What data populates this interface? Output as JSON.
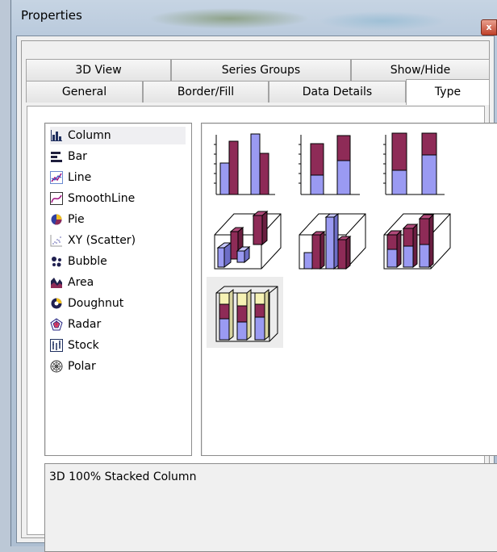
{
  "window": {
    "title": "Properties",
    "close_glyph": "x"
  },
  "tabs": {
    "row1": [
      {
        "label": "3D View"
      },
      {
        "label": "Series Groups"
      },
      {
        "label": "Show/Hide"
      }
    ],
    "row2": [
      {
        "label": "General"
      },
      {
        "label": "Border/Fill"
      },
      {
        "label": "Data Details"
      },
      {
        "label": "Type",
        "active": true
      }
    ]
  },
  "chart_types": [
    {
      "label": "Column",
      "icon": "column-chart-icon",
      "selected": true
    },
    {
      "label": "Bar",
      "icon": "bar-chart-icon"
    },
    {
      "label": "Line",
      "icon": "line-chart-icon"
    },
    {
      "label": "SmoothLine",
      "icon": "smoothline-chart-icon"
    },
    {
      "label": "Pie",
      "icon": "pie-chart-icon"
    },
    {
      "label": "XY (Scatter)",
      "icon": "scatter-chart-icon"
    },
    {
      "label": "Bubble",
      "icon": "bubble-chart-icon"
    },
    {
      "label": "Area",
      "icon": "area-chart-icon"
    },
    {
      "label": "Doughnut",
      "icon": "doughnut-chart-icon"
    },
    {
      "label": "Radar",
      "icon": "radar-chart-icon"
    },
    {
      "label": "Stock",
      "icon": "stock-chart-icon"
    },
    {
      "label": "Polar",
      "icon": "polar-chart-icon"
    }
  ],
  "subtypes": [
    {
      "icon": "clustered-column-icon"
    },
    {
      "icon": "stacked-column-icon"
    },
    {
      "icon": "100-stacked-column-icon"
    },
    {
      "icon": "3d-column-icon"
    },
    {
      "icon": "3d-clustered-column-icon"
    },
    {
      "icon": "3d-stacked-column-icon"
    },
    {
      "icon": "3d-100-stacked-column-icon",
      "selected": true
    }
  ],
  "description": "3D 100% Stacked Column",
  "colors": {
    "series1": "#9a9af2",
    "series2": "#8e2b57",
    "series3": "#f6f2b4",
    "selection": "#efeff2"
  }
}
